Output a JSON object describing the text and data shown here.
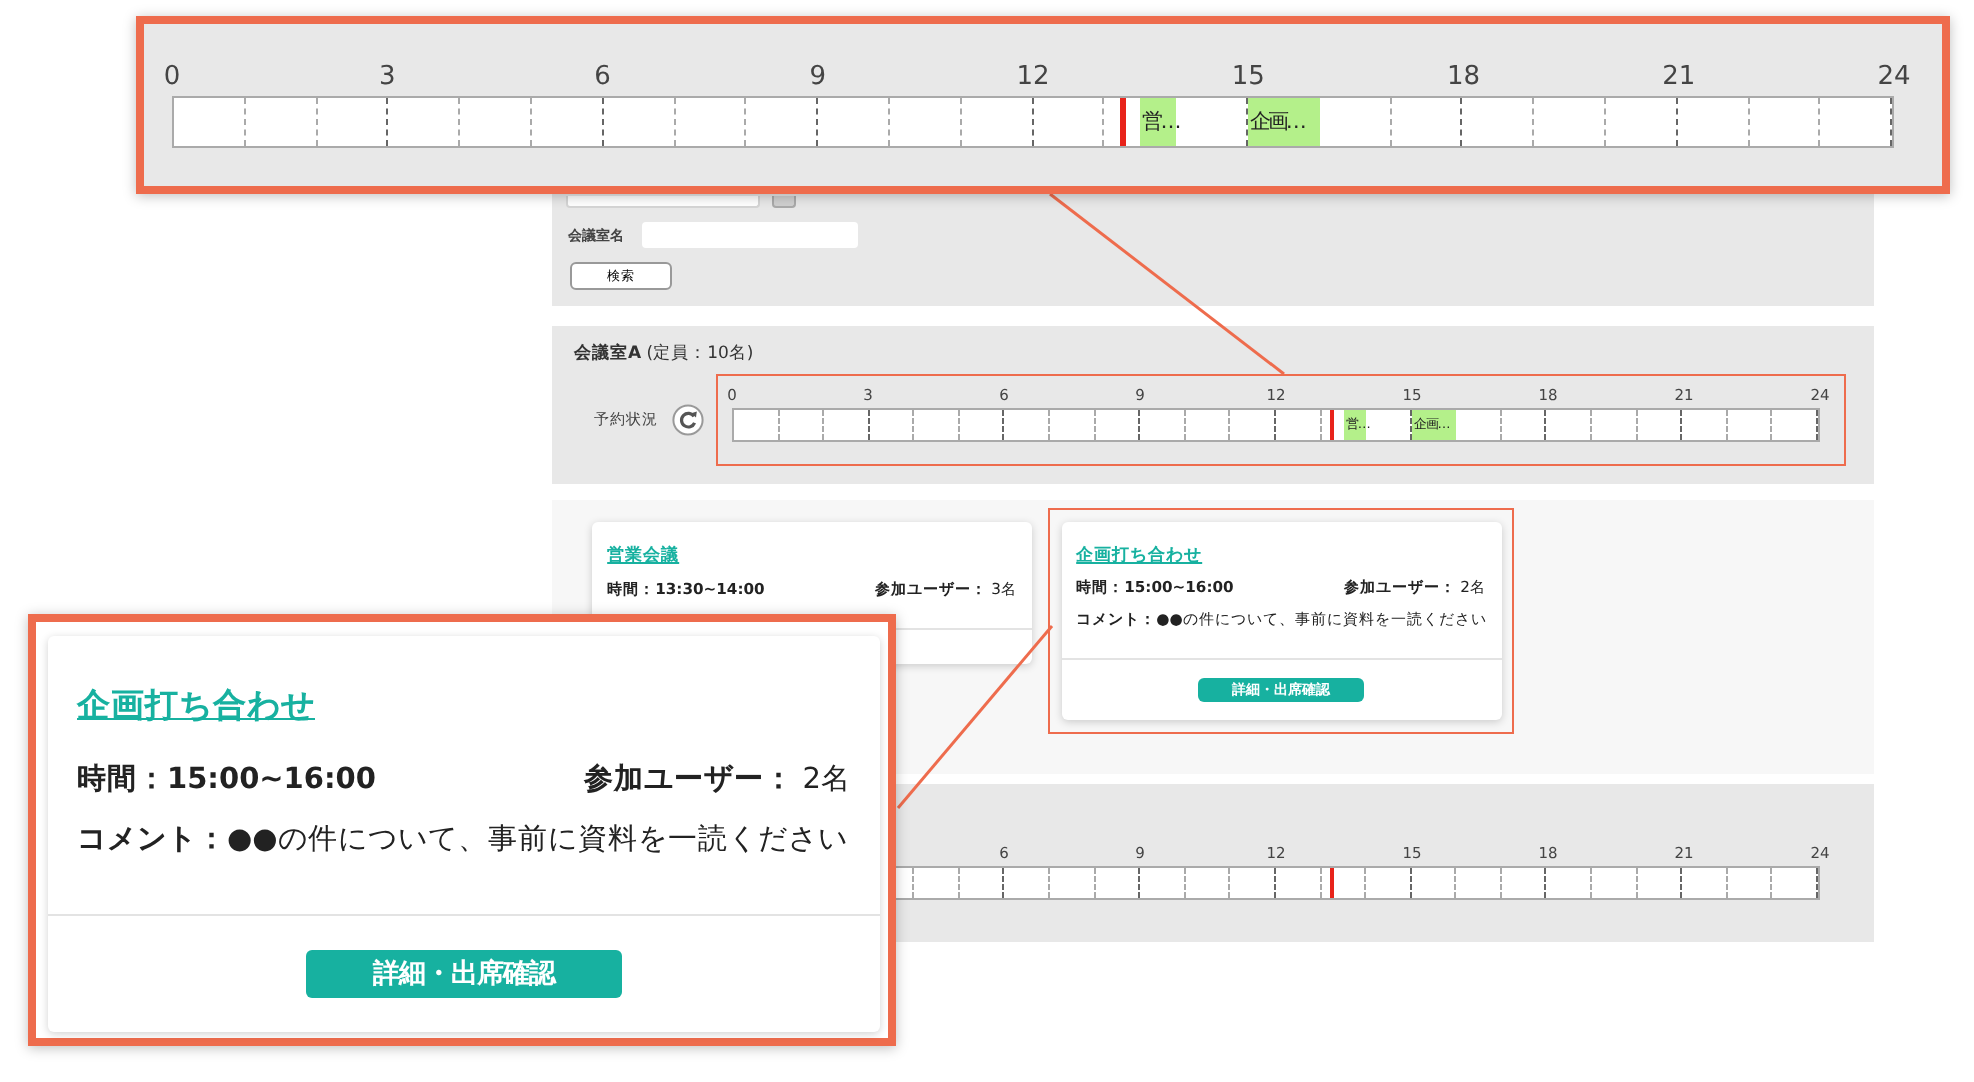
{
  "search": {
    "room_name_label": "会議室名",
    "search_button": "検索"
  },
  "rooms": [
    {
      "title": "**会議室A** (定員：10名)",
      "status_label": "予約状況",
      "highlighted": true,
      "timeline": {
        "ticks": [
          "0",
          "3",
          "6",
          "9",
          "12",
          "15",
          "18",
          "21",
          "24"
        ],
        "level": 0.552,
        "events": [
          {
            "label": "営…",
            "start": {
              "level": 0.5625
            },
            "end": {
              "level": 0.5833
            }
          },
          {
            "label": "企画…",
            "start": {
              "level": 0.625
            },
            "end": {
              "level": 0.6667
            }
          }
        ]
      },
      "meetings": [
        {
          "title": "営業会議",
          "time": "時間：13:30~14:00",
          "users_label": "参加ユーザー：",
          "users": "3名",
          "highlighted": false
        },
        {
          "title": "企画打ち合わせ",
          "time": "時間：15:00~16:00",
          "users_label": "参加ユーザー：",
          "users": "2名",
          "comment": "**コメント：**●●の件について、事前に資料を一読ください",
          "button": "詳細・出席確認",
          "highlighted": true
        }
      ]
    },
    {
      "highlighted": false,
      "timeline": {
        "ticks": [
          "6",
          "9",
          "12",
          "15",
          "18",
          "21",
          "24"
        ],
        "level": 0.552
      }
    }
  ],
  "callouts": [
    {
      "kind": "timeline",
      "timeline": {
        "ticks": [
          "0",
          "3",
          "6",
          "9",
          "12",
          "15",
          "18",
          "21",
          "24"
        ],
        "level": 0.552,
        "events": [
          {
            "label": "営…",
            "start": {
              "level": 0.5625
            },
            "end": {
              "level": 0.5833
            }
          },
          {
            "label": "企画…",
            "start": {
              "level": 0.625
            },
            "end": {
              "level": 0.6667
            }
          }
        ]
      }
    },
    {
      "kind": "card",
      "card": {
        "title": "企画打ち合わせ",
        "time": "時間：15:00~16:00",
        "users_label": "参加ユーザー：",
        "users": "2名",
        "comment": "**コメント：**●●の件について、事前に資料を一読ください",
        "button": "詳細・出席確認"
      }
    }
  ]
}
